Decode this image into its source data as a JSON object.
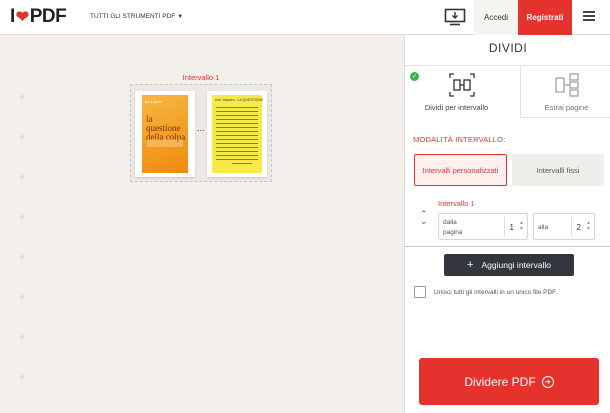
{
  "header": {
    "logo_left": "I",
    "logo_right": "PDF",
    "tools_label": "TUTTI GLI STRUMENTI PDF",
    "login_label": "Accedi",
    "register_label": "Registrati"
  },
  "workspace": {
    "range_label": "Intervallo 1",
    "thumb1": {
      "author": "Ira Lupes",
      "title": "la questione della colpa"
    },
    "thumb2": {
      "header": "Karl Jaspers - LA QUESTIONE"
    },
    "ellipsis": "..."
  },
  "sidebar": {
    "title": "DIVIDI",
    "options": [
      {
        "label": "Dividi per intervallo",
        "selected": true
      },
      {
        "label": "Estrai pagine",
        "selected": false
      }
    ],
    "mode_label": "MODALITÀ INTERVALLO:",
    "mode_custom": "Intervalli personalizzati",
    "mode_fixed": "Intervalli fissi",
    "interval_label": "Intervallo 1",
    "from_label": "dalla pagina",
    "from_value": "1",
    "to_label": "alla",
    "to_value": "2",
    "add_label": "Aggiungi intervallo",
    "merge_label": "Unisci tutti gli intervalli in un unico file PDF.",
    "split_label": "Dividere PDF"
  },
  "colors": {
    "accent": "#e5322d",
    "dark_button": "#33363d",
    "check": "#3cb44b"
  }
}
